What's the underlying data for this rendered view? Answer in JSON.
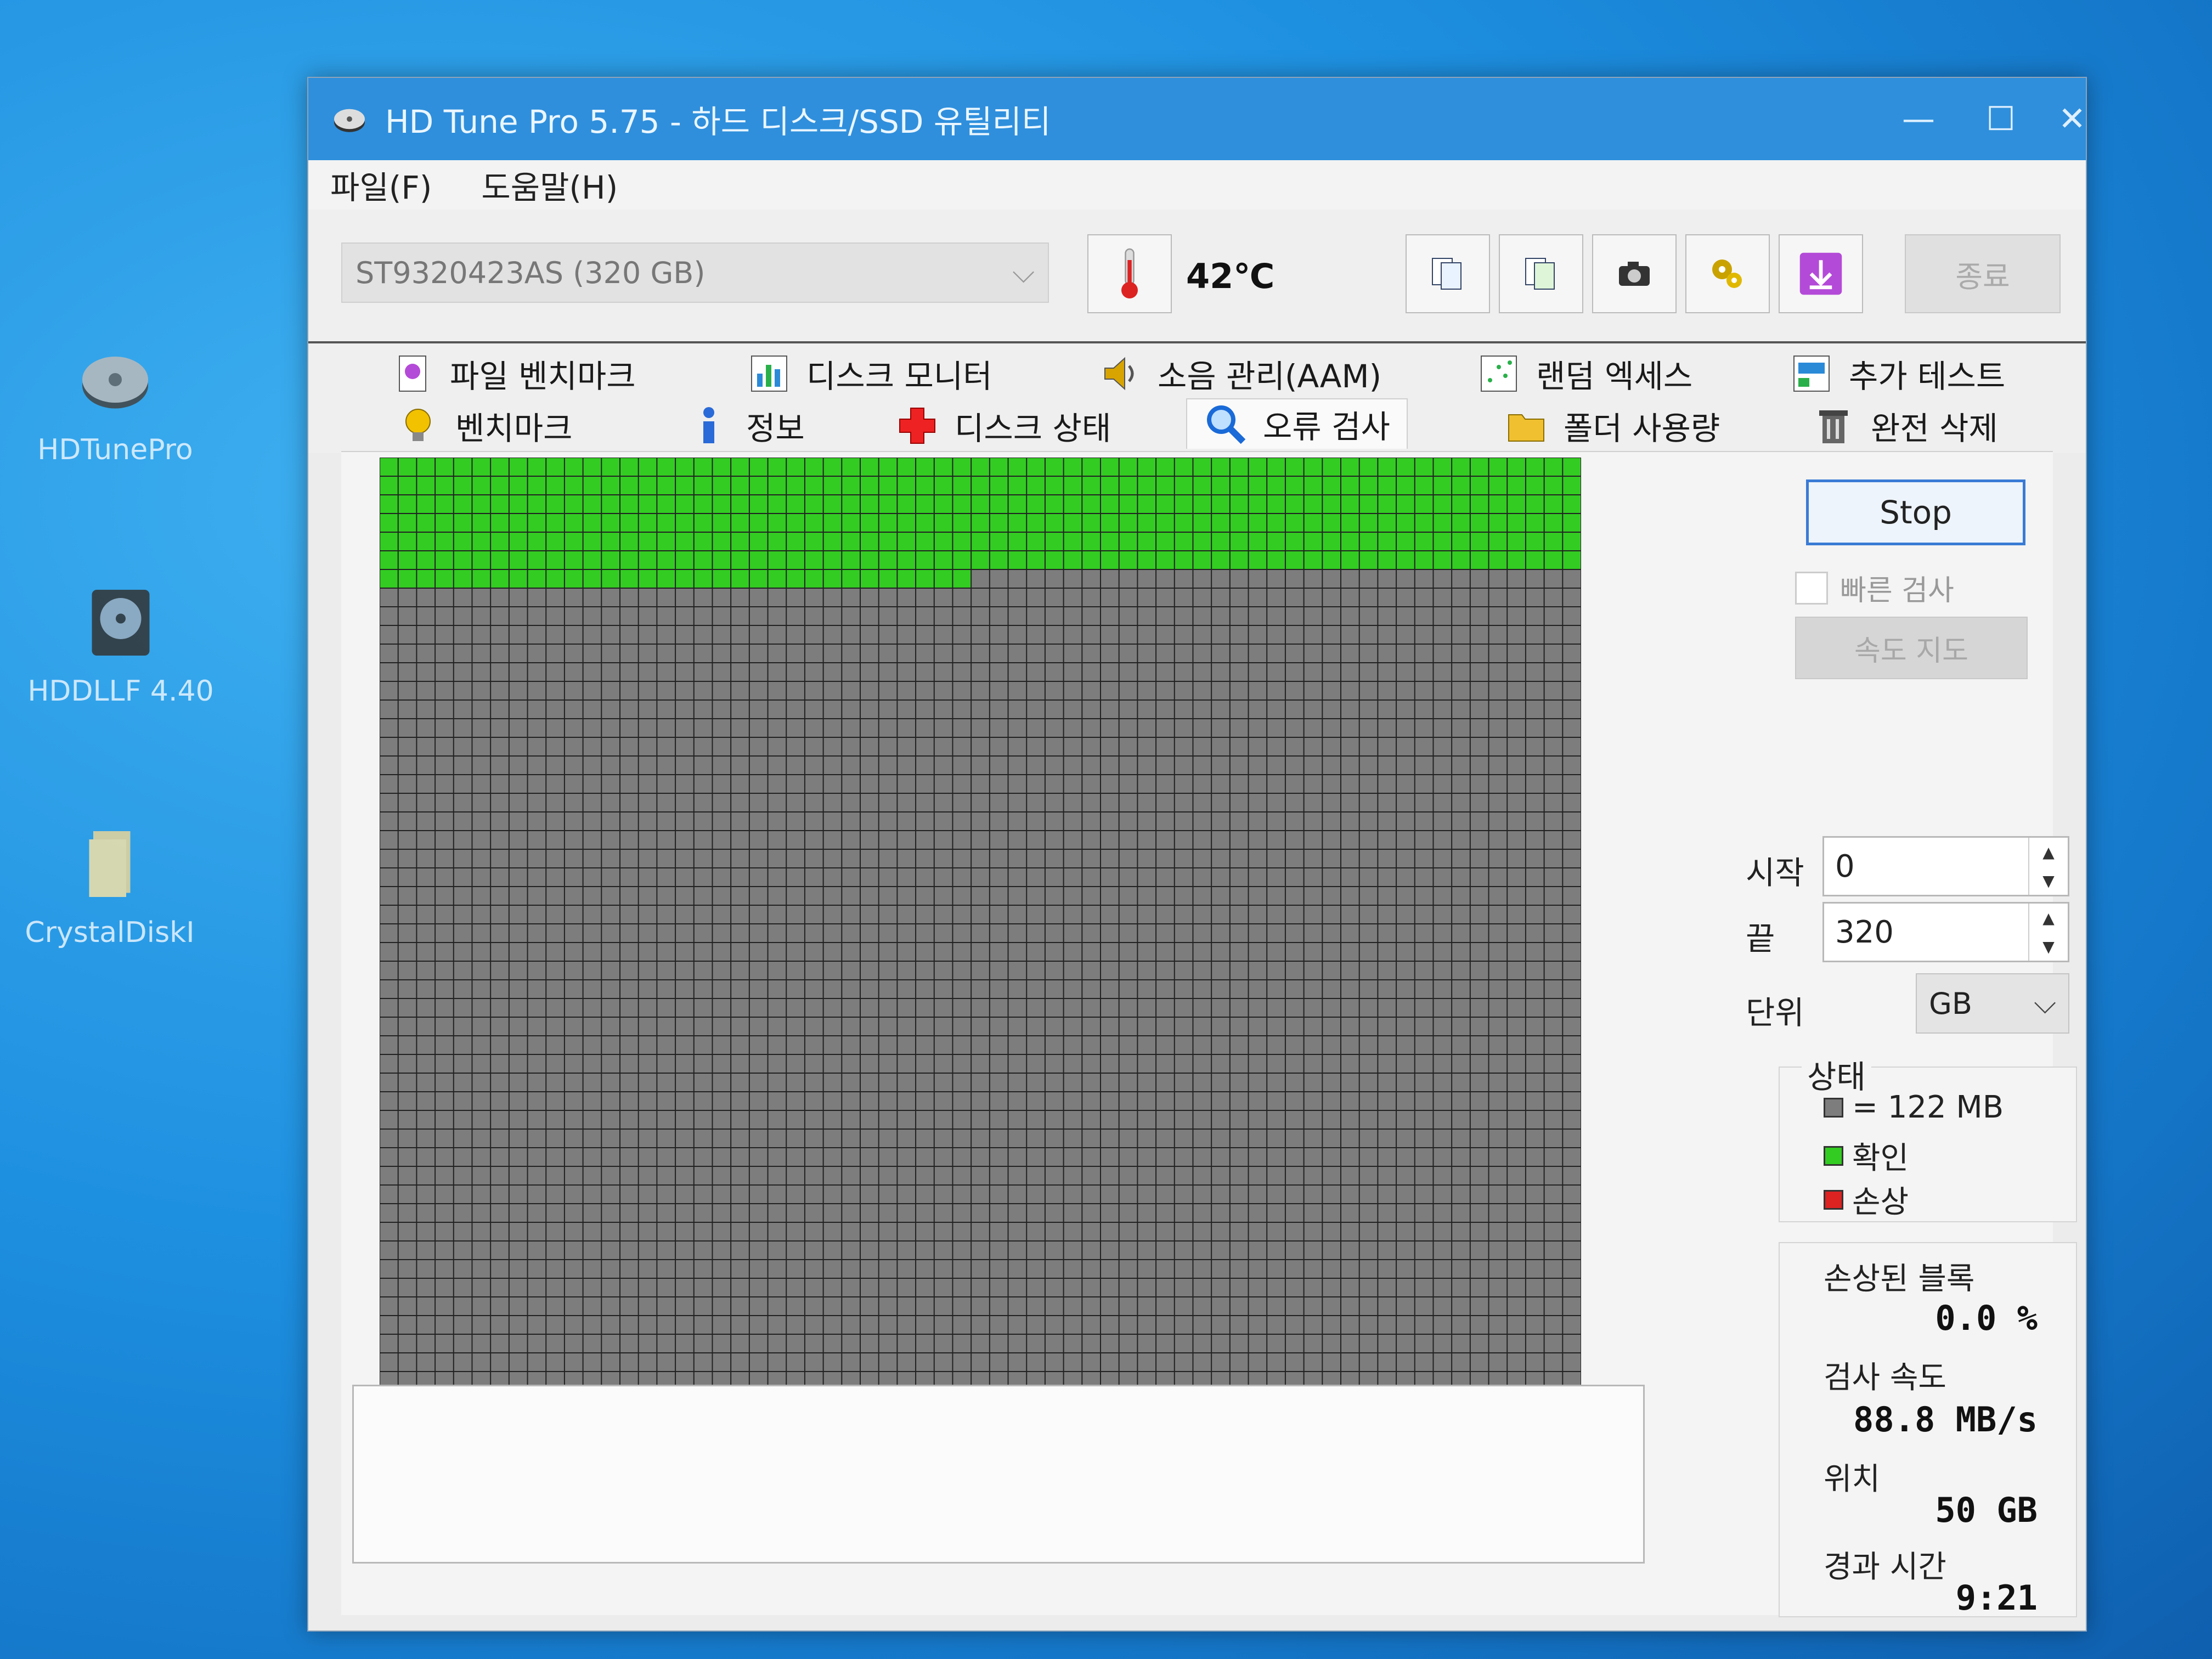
{
  "desktop": {
    "icons": [
      {
        "label": "HDTunePro"
      },
      {
        "label": "HDDLLF 4.40"
      },
      {
        "label": "CrystalDiskI"
      }
    ]
  },
  "window": {
    "title": "HD Tune Pro 5.75 - 하드 디스크/SSD 유틸리티",
    "controls": {
      "minimize": "—",
      "maximize": "☐",
      "close": "✕"
    }
  },
  "menu": {
    "file": "파일(F)",
    "help": "도움말(H)"
  },
  "toolbar": {
    "drive": "ST9320423AS (320 GB)",
    "temperature": "42℃",
    "exit_label": "종료"
  },
  "tabs": {
    "row1": [
      {
        "label": "파일 벤치마크",
        "icon": "file-benchmark-icon"
      },
      {
        "label": "디스크 모니터",
        "icon": "disk-monitor-icon"
      },
      {
        "label": "소음 관리(AAM)",
        "icon": "speaker-icon"
      },
      {
        "label": "랜덤 엑세스",
        "icon": "random-access-icon"
      },
      {
        "label": "추가 테스트",
        "icon": "extra-tests-icon"
      }
    ],
    "row2": [
      {
        "label": "벤치마크",
        "icon": "lightbulb-icon"
      },
      {
        "label": "정보",
        "icon": "info-icon"
      },
      {
        "label": "디스크 상태",
        "icon": "health-cross-icon"
      },
      {
        "label": "오류 검사",
        "icon": "magnifier-icon"
      },
      {
        "label": "폴더 사용량",
        "icon": "folder-icon"
      },
      {
        "label": "완전 삭제",
        "icon": "trash-icon"
      }
    ],
    "active": "오류 검사"
  },
  "scan": {
    "stop_label": "Stop",
    "quick_scan_label": "빠른 검사",
    "quick_scan_checked": false,
    "speed_map_label": "속도 지도",
    "start_label": "시작",
    "start_value": "0",
    "end_label": "끝",
    "end_value": "320",
    "unit_label": "단위",
    "unit_value": "GB",
    "legend_title": "상태",
    "legend": [
      {
        "label": "= 122 MB",
        "color": "#7d7d7d"
      },
      {
        "label": "확인",
        "color": "#33cc22"
      },
      {
        "label": "손상",
        "color": "#dd2222"
      }
    ],
    "damaged_label": "손상된 블록",
    "damaged_value": "0.0 %",
    "speed_label": "검사 속도",
    "speed_value": "88.8 MB/s",
    "position_label": "위치",
    "position_value": "50 GB",
    "elapsed_label": "경과 시간",
    "elapsed_value": "9:21"
  },
  "block_map": {
    "columns": 65,
    "rows": 50,
    "checked_blocks": 422,
    "damaged_blocks": 0,
    "colors": {
      "ok": "#33cc22",
      "pending": "#7d7d7d",
      "damaged": "#dd2222",
      "line": "#1a1a1a"
    }
  }
}
